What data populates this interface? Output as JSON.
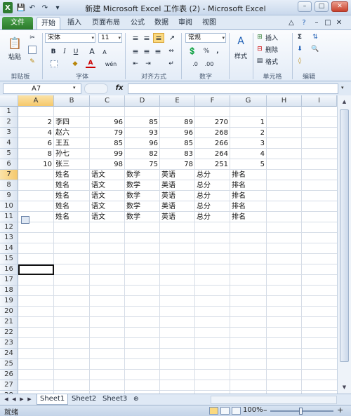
{
  "window": {
    "title": "新建 Microsoft Excel 工作表 (2) - Microsoft Excel",
    "controls": [
      "–",
      "□",
      "✕"
    ]
  },
  "quick_access": [
    "X",
    "💾",
    "↶",
    "↷",
    "▾"
  ],
  "tabs": [
    "文件",
    "开始",
    "插入",
    "页面布局",
    "公式",
    "数据",
    "审阅",
    "视图"
  ],
  "ribbon": {
    "clipboard": {
      "label": "剪贴板",
      "paste": "粘贴"
    },
    "font": {
      "label": "字体",
      "name": "宋体",
      "size": "11",
      "bold": "B",
      "italic": "I",
      "underline": "U",
      "grow": "A",
      "shrink": "A",
      "color_a": "A",
      "wen": "wén"
    },
    "alignment": {
      "label": "对齐方式"
    },
    "number": {
      "label": "数字",
      "format": "常规",
      "percent": "%",
      "comma": ","
    },
    "styles": {
      "label": "样式",
      "button": "样式"
    },
    "cells": {
      "label": "单元格",
      "insert": "插入",
      "delete": "删除",
      "format": "格式"
    },
    "editing": {
      "label": "编辑",
      "sum": "Σ"
    }
  },
  "formula_bar": {
    "name_box": "A7",
    "fx": "fx",
    "content": ""
  },
  "columns": [
    "A",
    "B",
    "C",
    "D",
    "E",
    "F",
    "G",
    "H",
    "I"
  ],
  "rows": [
    "1",
    "2",
    "3",
    "4",
    "5",
    "6",
    "7",
    "8",
    "9",
    "10",
    "11",
    "12",
    "13",
    "14",
    "15",
    "16",
    "17",
    "18",
    "19",
    "20",
    "21",
    "22",
    "23",
    "24",
    "25",
    "26",
    "27",
    "28"
  ],
  "cells": {
    "r2": [
      "2",
      "李四",
      "96",
      "85",
      "89",
      "270",
      "1"
    ],
    "r3": [
      "4",
      "赵六",
      "79",
      "93",
      "96",
      "268",
      "2"
    ],
    "r4": [
      "6",
      "王五",
      "85",
      "96",
      "85",
      "266",
      "3"
    ],
    "r5": [
      "8",
      "孙七",
      "99",
      "82",
      "83",
      "264",
      "4"
    ],
    "r6": [
      "10",
      "张三",
      "98",
      "75",
      "78",
      "251",
      "5"
    ],
    "header_rows": [
      "姓名",
      "语文",
      "数学",
      "英语",
      "总分",
      "排名"
    ]
  },
  "sheets": [
    "Sheet1",
    "Sheet2",
    "Sheet3"
  ],
  "status": {
    "ready": "就绪",
    "zoom": "100%"
  }
}
